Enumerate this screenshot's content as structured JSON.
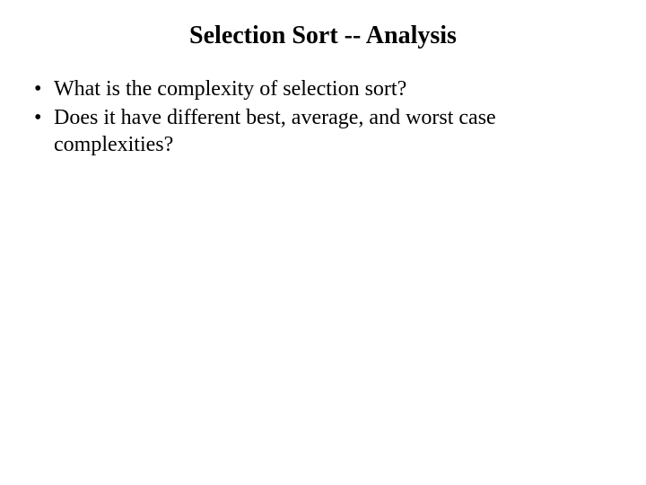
{
  "slide": {
    "title": "Selection Sort -- Analysis",
    "bullets": [
      "What is the complexity of selection sort?",
      "Does it have different best, average, and worst case complexities?"
    ]
  }
}
